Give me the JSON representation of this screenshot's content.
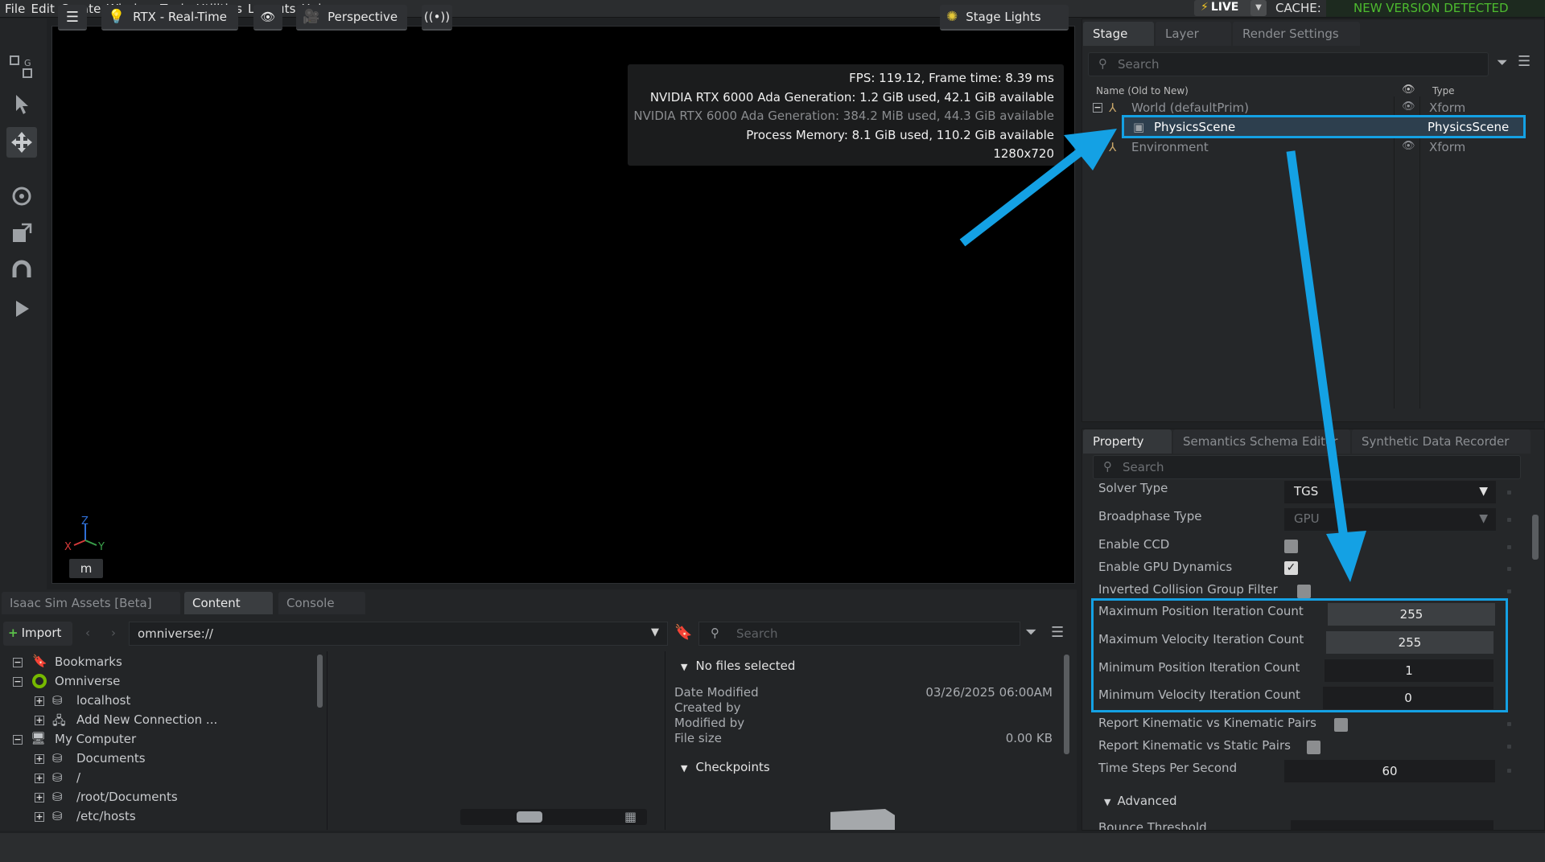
{
  "menu": [
    "File",
    "Edit",
    "Create",
    "Window",
    "Tools",
    "Utilities",
    "Layouts",
    "Help"
  ],
  "topright": {
    "live_label": "LIVE",
    "cache_label": "CACHE:",
    "new_version": "NEW VERSION DETECTED"
  },
  "viewport": {
    "render_mode": "RTX - Real-Time",
    "camera": "Perspective",
    "stage_lights": "Stage Lights",
    "stats": {
      "fps": "FPS: 119.12, Frame time: 8.39 ms",
      "gpu1": "NVIDIA RTX 6000 Ada Generation: 1.2 GiB used, 42.1 GiB available",
      "gpu2": "NVIDIA RTX 6000 Ada Generation: 384.2 MiB used, 44.3 GiB available",
      "process_memory": "Process Memory: 8.1 GiB used, 110.2 GiB available",
      "resolution": "1280x720"
    },
    "axis": {
      "z": "Z",
      "x": "X",
      "y": "Y"
    },
    "unit": "m"
  },
  "stage": {
    "tabs": [
      "Stage",
      "Layer",
      "Render Settings"
    ],
    "search_placeholder": "Search",
    "col_name": "Name (Old to New)",
    "col_type": "Type",
    "rows": [
      {
        "name": "World (defaultPrim)",
        "type": "Xform"
      },
      {
        "name": "PhysicsScene",
        "type": "PhysicsScene"
      },
      {
        "name": "Environment",
        "type": "Xform"
      }
    ]
  },
  "property": {
    "tabs": [
      "Property",
      "Semantics Schema Editor",
      "Synthetic Data Recorder"
    ],
    "search_placeholder": "Search",
    "solver_type_label": "Solver Type",
    "solver_type_value": "TGS",
    "broadphase_label": "Broadphase Type",
    "broadphase_value": "GPU",
    "enable_ccd": "Enable CCD",
    "enable_gpu_dynamics": "Enable GPU Dynamics",
    "inverted_collision": "Inverted Collision Group Filter",
    "max_pos_label": "Maximum Position Iteration Count",
    "max_pos_value": "255",
    "max_vel_label": "Maximum Velocity Iteration Count",
    "max_vel_value": "255",
    "min_pos_label": "Minimum Position Iteration Count",
    "min_pos_value": "1",
    "min_vel_label": "Minimum Velocity Iteration Count",
    "min_vel_value": "0",
    "report_kin_kin": "Report Kinematic vs Kinematic Pairs",
    "report_kin_static": "Report Kinematic vs Static Pairs",
    "time_steps_label": "Time Steps Per Second",
    "time_steps_value": "60",
    "advanced": "Advanced",
    "bounce_label": "Bounce Threshold"
  },
  "content": {
    "tabs": [
      "Isaac Sim Assets [Beta]",
      "Content",
      "Console"
    ],
    "import_label": "Import",
    "path": "omniverse://",
    "search_placeholder": "Search",
    "tree": [
      {
        "label": "Bookmarks",
        "level": 0,
        "pm": "−"
      },
      {
        "label": "Omniverse",
        "level": 0,
        "pm": "−"
      },
      {
        "label": "localhost",
        "level": 1,
        "pm": "+"
      },
      {
        "label": "Add New Connection ...",
        "level": 1,
        "pm": "+"
      },
      {
        "label": "My Computer",
        "level": 0,
        "pm": "−"
      },
      {
        "label": "Documents",
        "level": 1,
        "pm": "+"
      },
      {
        "label": "/",
        "level": 1,
        "pm": "+"
      },
      {
        "label": "/root/Documents",
        "level": 1,
        "pm": "+"
      },
      {
        "label": "/etc/hosts",
        "level": 1,
        "pm": "+"
      }
    ],
    "no_files": "No files selected",
    "date_modified_label": "Date Modified",
    "date_modified_value": "03/26/2025 06:00AM",
    "created_by_label": "Created by",
    "modified_by_label": "Modified by",
    "file_size_label": "File size",
    "file_size_value": "0.00 KB",
    "checkpoints": "Checkpoints"
  },
  "colors": {
    "highlight": "#14a1e4",
    "live_bolt": "#f3c623",
    "new_version": "#4dbb2f",
    "omniverse_green": "#76b900"
  }
}
